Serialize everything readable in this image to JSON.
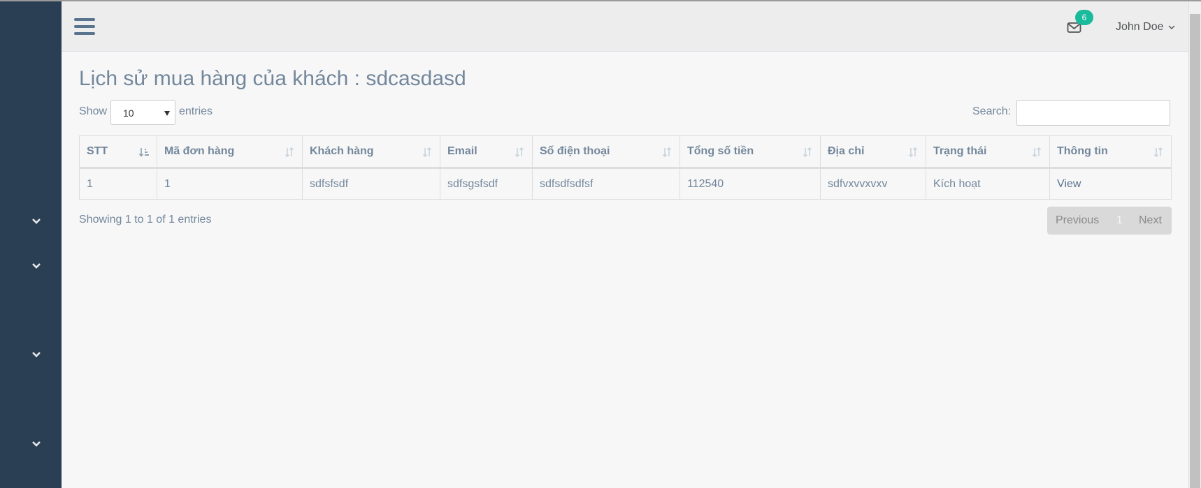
{
  "header": {
    "notification_count": "6",
    "user_name": "John Doe",
    "icons": [
      "menu-icon",
      "mail-icon",
      "chevron-down-icon"
    ]
  },
  "sidebar": {
    "icons": [
      "chevron-down-icon",
      "chevron-down-icon",
      "chevron-down-icon",
      "chevron-down-icon"
    ]
  },
  "page": {
    "title": "Lịch sử mua hàng của khách : sdcasdasd"
  },
  "controls": {
    "show_label": "Show",
    "entries_value": "10",
    "entries_label": "entries",
    "search_label": "Search:",
    "search_value": ""
  },
  "table": {
    "columns": [
      "STT",
      "Mã đơn hàng",
      "Khách hàng",
      "Email",
      "Số điện thoại",
      "Tổng số tiền",
      "Địa chỉ",
      "Trạng thái",
      "Thông tin"
    ],
    "sorted_column": "STT",
    "rows": [
      [
        "1",
        "1",
        "sdfsfsdf",
        "sdfsgsfsdf",
        "sdfsdfsdfsf",
        "112540",
        "sdfvxvvxvxv",
        "Kích hoạt",
        "View"
      ]
    ]
  },
  "footer": {
    "info": "Showing 1 to 1 of 1 entries",
    "prev_label": "Previous",
    "current_page": "1",
    "next_label": "Next"
  },
  "colors": {
    "sidebar": "#2a3f54",
    "badge": "#1abb9c",
    "text": "#73879c"
  }
}
